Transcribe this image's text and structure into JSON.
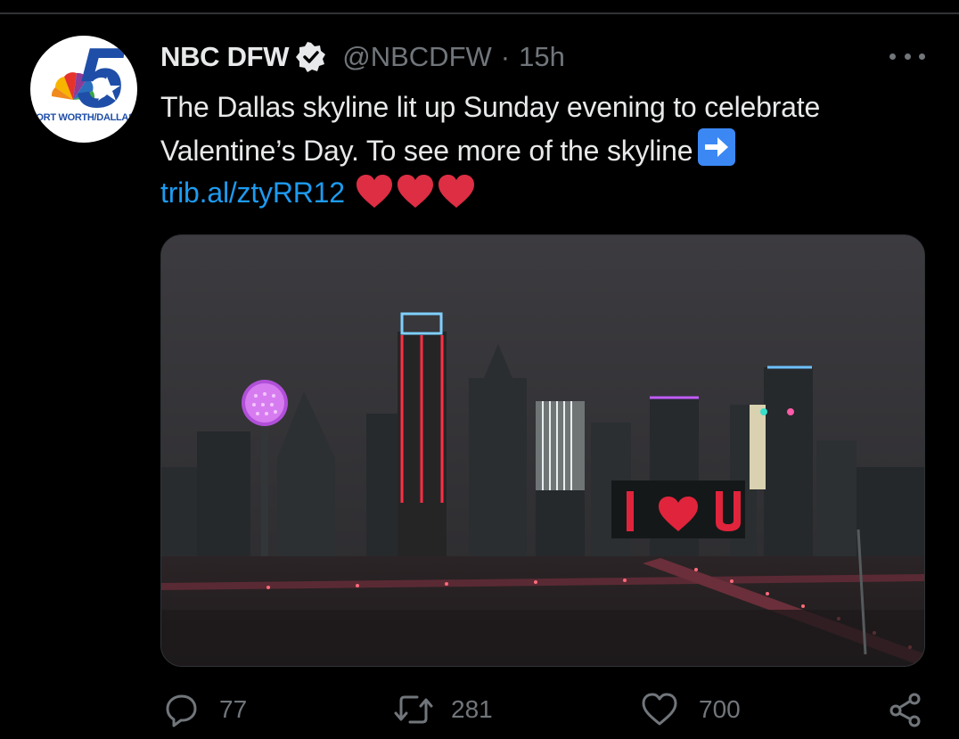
{
  "author": {
    "display_name": "NBC DFW",
    "handle": "@NBCDFW",
    "separator": "·",
    "time_ago": "15h",
    "verified": true,
    "avatar_text": "FORT WORTH/DALLAS"
  },
  "tweet": {
    "line1": "The Dallas skyline lit up Sunday evening to celebrate",
    "line2": "Valentine’s Day. To see more of the skyline",
    "link": "trib.al/ztyRR12",
    "emoji": [
      "right-arrow",
      "red-heart",
      "red-heart",
      "red-heart"
    ]
  },
  "media": {
    "sign_text": "I ♥ U"
  },
  "actions": {
    "replies": "77",
    "retweets": "281",
    "likes": "700"
  },
  "colors": {
    "background": "#000000",
    "text": "#e7e9ea",
    "secondary": "#71767b",
    "link": "#1d9bf0",
    "divider": "#2f3336"
  }
}
